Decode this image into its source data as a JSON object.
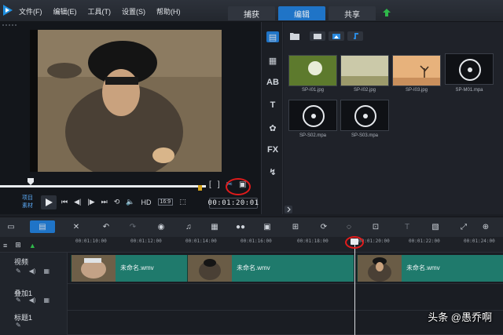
{
  "menu": {
    "items": [
      {
        "label": "文件(F)"
      },
      {
        "label": "编辑(E)"
      },
      {
        "label": "工具(T)"
      },
      {
        "label": "设置(S)"
      },
      {
        "label": "帮助(H)"
      }
    ]
  },
  "workspace_tabs": [
    {
      "label": "捕获",
      "active": false
    },
    {
      "label": "编辑",
      "active": true
    },
    {
      "label": "共享",
      "active": false
    }
  ],
  "player": {
    "source_labels": [
      "项目",
      "素材"
    ],
    "quality": "HD",
    "aspect": "16:9",
    "timecode": "00:01:20:01",
    "progress": 0.15
  },
  "library": {
    "items": [
      {
        "name": "SP-I01.jpg",
        "kind": "image",
        "subject": "dandelion"
      },
      {
        "name": "SP-I02.jpg",
        "kind": "image",
        "subject": "grass-field"
      },
      {
        "name": "SP-I03.jpg",
        "kind": "image",
        "subject": "desert-tree"
      },
      {
        "name": "SP-M01.mpa",
        "kind": "audio"
      },
      {
        "name": "SP-S02.mpa",
        "kind": "audio"
      },
      {
        "name": "SP-S03.mpa",
        "kind": "audio"
      }
    ]
  },
  "timeline": {
    "ruler": [
      "00:01:10:00",
      "00:01:12:00",
      "00:01:14:00",
      "00:01:16:00",
      "00:01:18:00",
      "00:01:20:00",
      "00:01:22:00",
      "00:01:24:00"
    ],
    "tracks": [
      {
        "name": "视频"
      },
      {
        "name": "叠加1"
      },
      {
        "name": "标题1"
      }
    ],
    "clips": [
      {
        "label": "未命名.wmv"
      },
      {
        "label": "未命名.wmv"
      },
      {
        "label": "未命名.wmv"
      }
    ]
  },
  "colors": {
    "accent": "#1f74c7",
    "clip": "#1f7a6c",
    "highlight": "#e11b1b"
  },
  "watermark": "头条 @愚乔啊"
}
